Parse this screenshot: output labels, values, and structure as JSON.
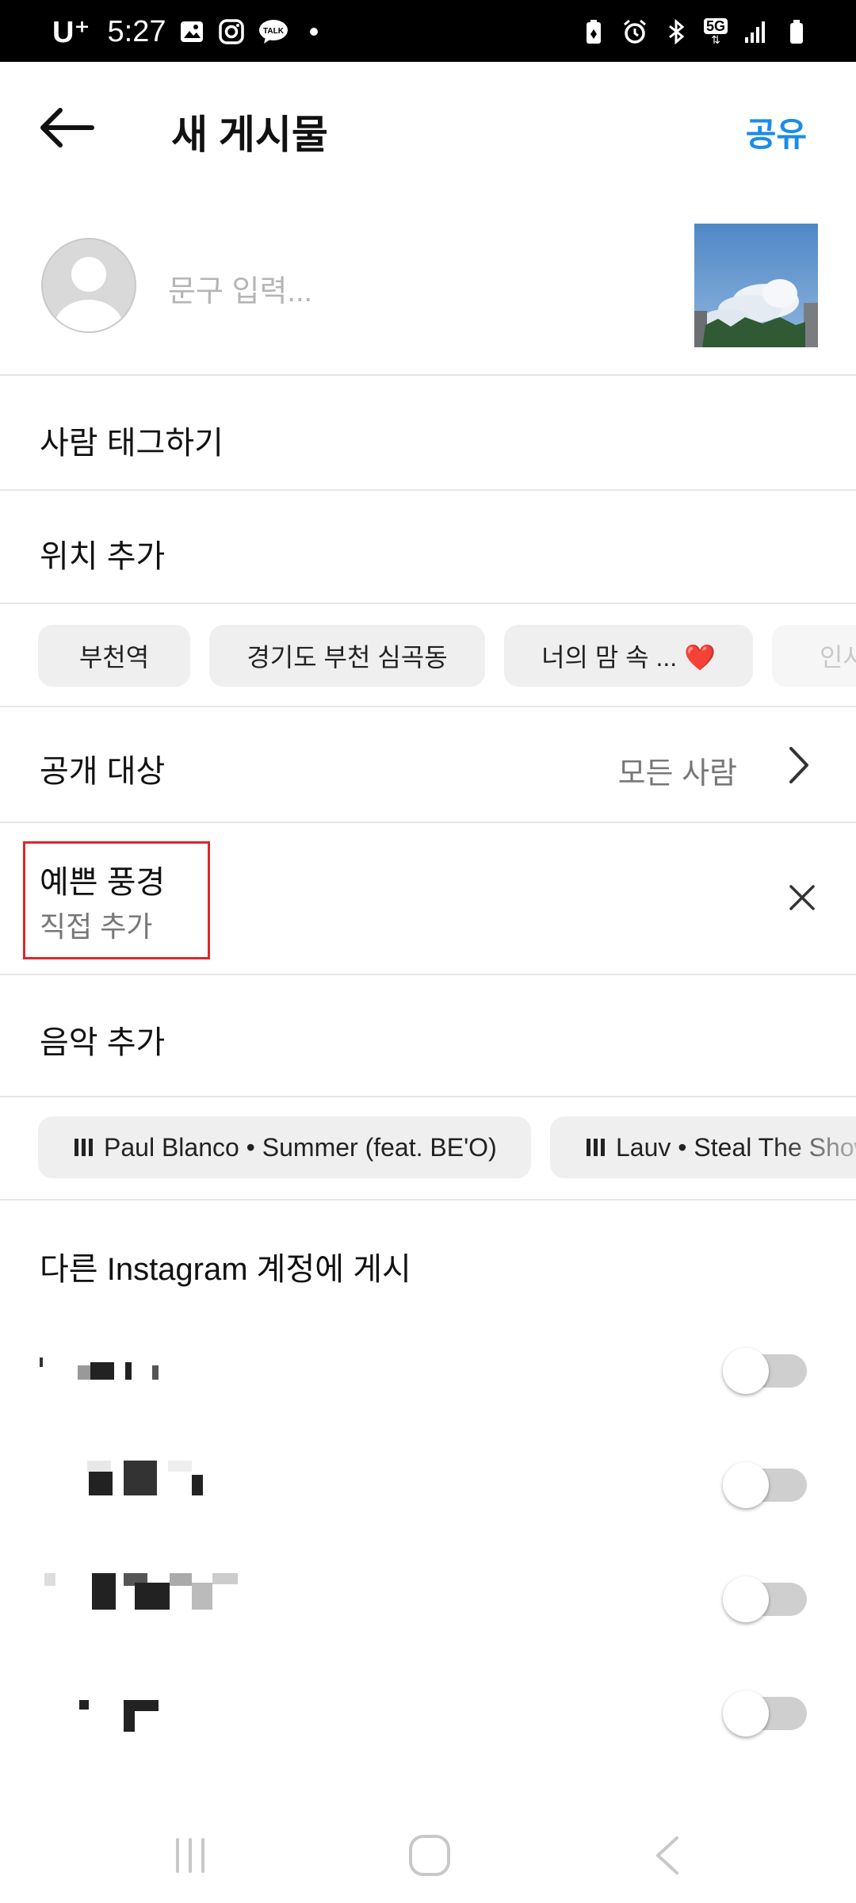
{
  "status_bar": {
    "carrier": "U⁺",
    "time": "5:27",
    "network": "5G"
  },
  "header": {
    "title": "새 게시물",
    "share_label": "공유"
  },
  "composer": {
    "caption_placeholder": "문구 입력..."
  },
  "menu": {
    "tag_people": "사람 태그하기",
    "add_location": "위치 추가"
  },
  "location_suggestions": [
    "부천역",
    "경기도 부천 심곡동",
    "너의 맘 속 ... ❤️",
    "인사"
  ],
  "audience": {
    "label": "공개 대상",
    "value": "모든 사람"
  },
  "topic": {
    "title": "예쁜 풍경",
    "subtitle": "직접 추가"
  },
  "music": {
    "label": "음악 추가",
    "suggestions": [
      "Paul Blanco • Summer (feat. BE'O)",
      "Lauv • Steal The Show"
    ]
  },
  "other_accounts": {
    "title": "다른 Instagram 계정에 게시",
    "toggles": [
      false,
      false,
      false,
      false
    ]
  },
  "colors": {
    "accent": "#1a8ce8",
    "highlight_box": "#e0252a"
  }
}
